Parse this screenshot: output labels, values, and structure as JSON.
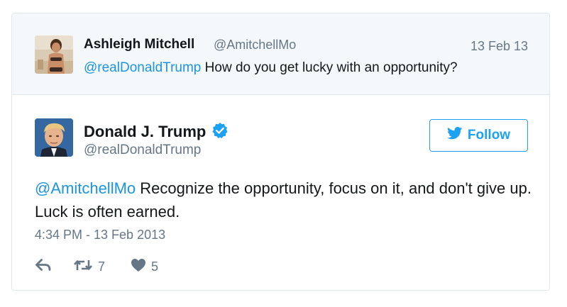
{
  "parent_tweet": {
    "author_name": "Ashleigh Mitchell",
    "author_handle": "@AmitchellMo",
    "date": "13 Feb 13",
    "mention": "@realDonaldTrump",
    "text": " How do you get lucky with an opportunity?"
  },
  "tweet": {
    "author_name": "Donald J. Trump",
    "author_handle": "@realDonaldTrump",
    "verified": true,
    "follow_label": "Follow",
    "mention": "@AmitchellMo",
    "text": " Recognize the opportunity, focus on it, and don't give up. Luck is often earned.",
    "timestamp": "4:34 PM - 13 Feb 2013",
    "retweet_count": "7",
    "like_count": "5"
  },
  "icons": {
    "verified": "verified-badge-icon",
    "follow": "twitter-bird-icon",
    "reply": "reply-arrow-icon",
    "retweet": "retweet-icon",
    "like": "heart-icon"
  },
  "colors": {
    "accent": "#1da1f2",
    "link": "#1b95e0",
    "muted": "#657786",
    "text": "#14171a",
    "parent_background": "#f5f8fa",
    "border": "#e1e8ed"
  }
}
